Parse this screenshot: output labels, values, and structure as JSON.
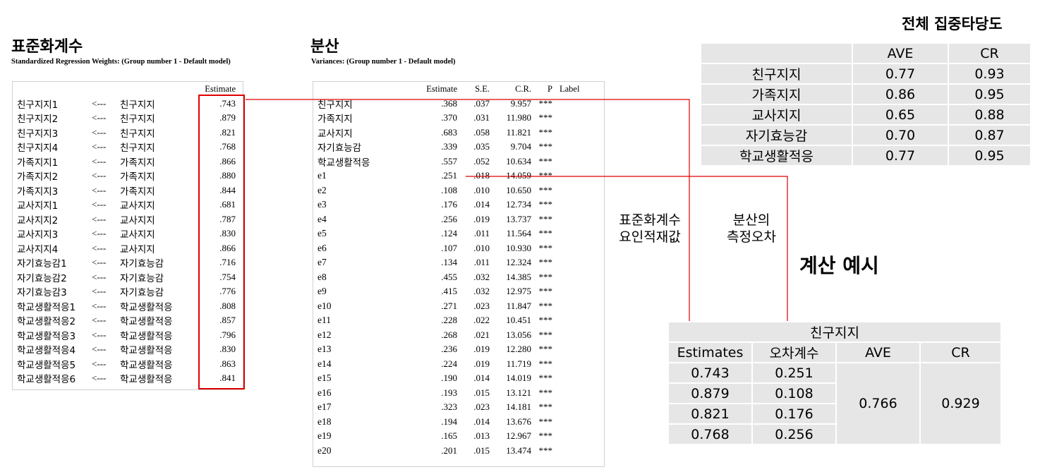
{
  "left": {
    "title": "표준화계수",
    "subtitle": "Standardized Regression Weights: (Group number 1 - Default model)",
    "col_header": "Estimate",
    "rows": [
      {
        "ind": "친구지지1",
        "arrow": "<---",
        "factor": "친구지지",
        "est": ".743"
      },
      {
        "ind": "친구지지2",
        "arrow": "<---",
        "factor": "친구지지",
        "est": ".879"
      },
      {
        "ind": "친구지지3",
        "arrow": "<---",
        "factor": "친구지지",
        "est": ".821"
      },
      {
        "ind": "친구지지4",
        "arrow": "<---",
        "factor": "친구지지",
        "est": ".768"
      },
      {
        "ind": "가족지지1",
        "arrow": "<---",
        "factor": "가족지지",
        "est": ".866"
      },
      {
        "ind": "가족지지2",
        "arrow": "<---",
        "factor": "가족지지",
        "est": ".880"
      },
      {
        "ind": "가족지지3",
        "arrow": "<---",
        "factor": "가족지지",
        "est": ".844"
      },
      {
        "ind": "교사지지1",
        "arrow": "<---",
        "factor": "교사지지",
        "est": ".681"
      },
      {
        "ind": "교사지지2",
        "arrow": "<---",
        "factor": "교사지지",
        "est": ".787"
      },
      {
        "ind": "교사지지3",
        "arrow": "<---",
        "factor": "교사지지",
        "est": ".830"
      },
      {
        "ind": "교사지지4",
        "arrow": "<---",
        "factor": "교사지지",
        "est": ".866"
      },
      {
        "ind": "자기효능감1",
        "arrow": "<---",
        "factor": "자기효능감",
        "est": ".716"
      },
      {
        "ind": "자기효능감2",
        "arrow": "<---",
        "factor": "자기효능감",
        "est": ".754"
      },
      {
        "ind": "자기효능감3",
        "arrow": "<---",
        "factor": "자기효능감",
        "est": ".776"
      },
      {
        "ind": "학교생활적응1",
        "arrow": "<---",
        "factor": "학교생활적응",
        "est": ".808"
      },
      {
        "ind": "학교생활적응2",
        "arrow": "<---",
        "factor": "학교생활적응",
        "est": ".857"
      },
      {
        "ind": "학교생활적응3",
        "arrow": "<---",
        "factor": "학교생활적응",
        "est": ".796"
      },
      {
        "ind": "학교생활적응4",
        "arrow": "<---",
        "factor": "학교생활적응",
        "est": ".830"
      },
      {
        "ind": "학교생활적응5",
        "arrow": "<---",
        "factor": "학교생활적응",
        "est": ".863"
      },
      {
        "ind": "학교생활적응6",
        "arrow": "<---",
        "factor": "학교생활적응",
        "est": ".841"
      }
    ]
  },
  "middle": {
    "title": "분산",
    "subtitle": "Variances: (Group number 1 - Default model)",
    "headers": [
      "Estimate",
      "S.E.",
      "C.R.",
      "P",
      "Label"
    ],
    "rows": [
      {
        "name": "친구지지",
        "est": ".368",
        "se": ".037",
        "cr": "9.957",
        "p": "***"
      },
      {
        "name": "가족지지",
        "est": ".370",
        "se": ".031",
        "cr": "11.980",
        "p": "***"
      },
      {
        "name": "교사지지",
        "est": ".683",
        "se": ".058",
        "cr": "11.821",
        "p": "***"
      },
      {
        "name": "자기효능감",
        "est": ".339",
        "se": ".035",
        "cr": "9.704",
        "p": "***"
      },
      {
        "name": "학교생활적응",
        "est": ".557",
        "se": ".052",
        "cr": "10.634",
        "p": "***"
      },
      {
        "name": "e1",
        "est": ".251",
        "se": ".018",
        "cr": "14.059",
        "p": "***"
      },
      {
        "name": "e2",
        "est": ".108",
        "se": ".010",
        "cr": "10.650",
        "p": "***"
      },
      {
        "name": "e3",
        "est": ".176",
        "se": ".014",
        "cr": "12.734",
        "p": "***"
      },
      {
        "name": "e4",
        "est": ".256",
        "se": ".019",
        "cr": "13.737",
        "p": "***"
      },
      {
        "name": "e5",
        "est": ".124",
        "se": ".011",
        "cr": "11.564",
        "p": "***"
      },
      {
        "name": "e6",
        "est": ".107",
        "se": ".010",
        "cr": "10.930",
        "p": "***"
      },
      {
        "name": "e7",
        "est": ".134",
        "se": ".011",
        "cr": "12.324",
        "p": "***"
      },
      {
        "name": "e8",
        "est": ".455",
        "se": ".032",
        "cr": "14.385",
        "p": "***"
      },
      {
        "name": "e9",
        "est": ".415",
        "se": ".032",
        "cr": "12.975",
        "p": "***"
      },
      {
        "name": "e10",
        "est": ".271",
        "se": ".023",
        "cr": "11.847",
        "p": "***"
      },
      {
        "name": "e11",
        "est": ".228",
        "se": ".022",
        "cr": "10.451",
        "p": "***"
      },
      {
        "name": "e12",
        "est": ".268",
        "se": ".021",
        "cr": "13.056",
        "p": "***"
      },
      {
        "name": "e13",
        "est": ".236",
        "se": ".019",
        "cr": "12.280",
        "p": "***"
      },
      {
        "name": "e14",
        "est": ".224",
        "se": ".019",
        "cr": "11.719",
        "p": "***"
      },
      {
        "name": "e15",
        "est": ".190",
        "se": ".014",
        "cr": "14.019",
        "p": "***"
      },
      {
        "name": "e16",
        "est": ".193",
        "se": ".015",
        "cr": "13.121",
        "p": "***"
      },
      {
        "name": "e17",
        "est": ".323",
        "se": ".023",
        "cr": "14.181",
        "p": "***"
      },
      {
        "name": "e18",
        "est": ".194",
        "se": ".014",
        "cr": "13.676",
        "p": "***"
      },
      {
        "name": "e19",
        "est": ".165",
        "se": ".013",
        "cr": "12.967",
        "p": "***"
      },
      {
        "name": "e20",
        "est": ".201",
        "se": ".015",
        "cr": "13.474",
        "p": "***"
      }
    ]
  },
  "summary": {
    "title": "전체 집중타당도",
    "headers": [
      "",
      "AVE",
      "CR"
    ],
    "rows": [
      {
        "name": "친구지지",
        "ave": "0.77",
        "cr": "0.93"
      },
      {
        "name": "가족지지",
        "ave": "0.86",
        "cr": "0.95"
      },
      {
        "name": "교사지지",
        "ave": "0.65",
        "cr": "0.88"
      },
      {
        "name": "자기효능감",
        "ave": "0.70",
        "cr": "0.87"
      },
      {
        "name": "학교생활적응",
        "ave": "0.77",
        "cr": "0.95"
      }
    ]
  },
  "annotations": {
    "std_line1": "표준화계수",
    "std_line2": "요인적재값",
    "var_line1": "분산의",
    "var_line2": "측정오차",
    "example_title": "계산 예시"
  },
  "example": {
    "group": "친구지지",
    "headers": [
      "Estimates",
      "오차계수",
      "AVE",
      "CR"
    ],
    "rows": [
      {
        "est": "0.743",
        "err": "0.251"
      },
      {
        "est": "0.879",
        "err": "0.108"
      },
      {
        "est": "0.821",
        "err": "0.176"
      },
      {
        "est": "0.768",
        "err": "0.256"
      }
    ],
    "ave": "0.766",
    "cr": "0.929"
  },
  "colors": {
    "highlight": "#e00000",
    "table_gray": "#e6e6e6"
  }
}
